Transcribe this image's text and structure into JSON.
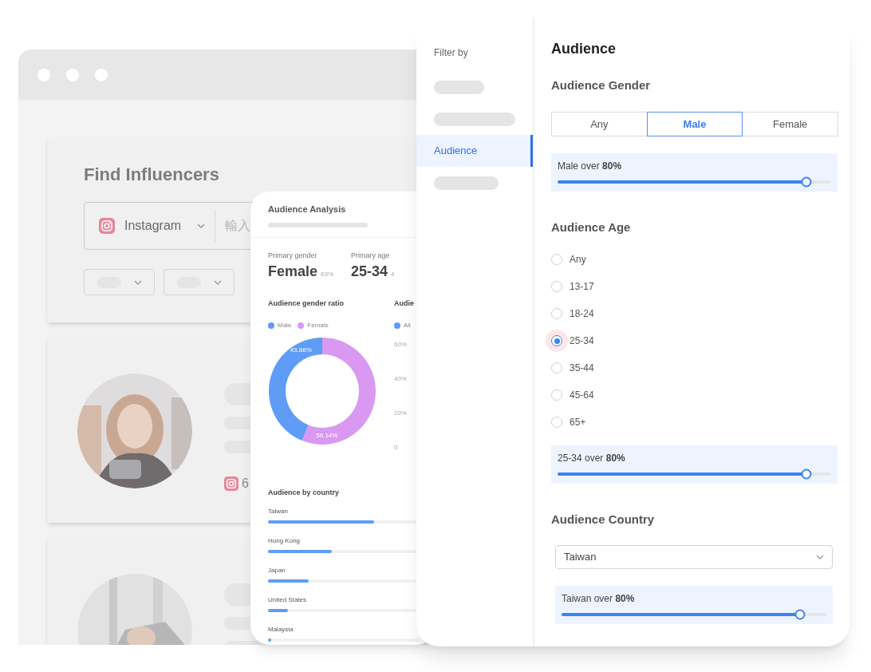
{
  "background_window": {
    "title": "Find Influencers",
    "platform_select": {
      "value": "Instagram"
    },
    "search": {
      "placeholder": "輸入"
    },
    "filters": [
      {
        "kind": "skeleton"
      },
      {
        "kind": "skeleton"
      }
    ],
    "results": [
      {
        "avatar": {
          "kind": "picture"
        },
        "follower_count": "6"
      },
      {
        "avatar": {
          "kind": "picture"
        }
      }
    ]
  },
  "analysis": {
    "title": "Audience Analysis",
    "primary_gender": {
      "label": "Primary gender",
      "value": "Female",
      "share": "63%"
    },
    "primary_age": {
      "label": "Primary age",
      "value": "25-34",
      "share": "4"
    },
    "gender_ratio": {
      "title": "Audience gender ratio",
      "legend": [
        {
          "color": "#5e9cf6"
        },
        {
          "color": "#d998f1"
        }
      ],
      "chart_data": {
        "type": "donut",
        "categories": [
          "Male",
          "Female"
        ],
        "series": [
          {
            "values": [
              43.86,
              56.14
            ]
          }
        ],
        "value_labels": [
          "43.86%",
          "56.14%"
        ]
      }
    },
    "age_chart": {
      "title": "Audie",
      "legend": [
        {
          "label": "All",
          "color": "#5e9cf6"
        }
      ],
      "axis_labels": [
        "60%",
        "40%",
        "20%",
        "0"
      ]
    },
    "by_country": {
      "title": "Audience by country",
      "countries": [
        {
          "name": "Taiwan",
          "level": 0.7
        },
        {
          "name": "Hong Kong",
          "level": 0.42
        },
        {
          "name": "Japan",
          "level": 0.27
        },
        {
          "name": "United States",
          "level": 0.13
        },
        {
          "name": "Malaysia",
          "level": 0.02
        }
      ]
    }
  },
  "filter_panel": {
    "sidebar": {
      "title": "Filter by",
      "items": [
        {
          "kind": "skeleton",
          "selected": false
        },
        {
          "kind": "skeleton",
          "selected": false
        },
        {
          "kind": "label",
          "label": "Audience",
          "selected": true
        },
        {
          "kind": "skeleton",
          "selected": false
        }
      ]
    },
    "title": "Audience",
    "sections": [
      {
        "kind": "segmented",
        "title": "Audience Gender",
        "options": [
          {
            "label": "Any",
            "selected": false
          },
          {
            "label": "Male",
            "selected": true
          },
          {
            "label": "Female",
            "selected": false
          }
        ],
        "threshold": {
          "label": "Male over **80%**",
          "level": 0.91
        }
      },
      {
        "kind": "radio",
        "title": "Audience Age",
        "options": [
          {
            "label": "Any",
            "selected": false
          },
          {
            "label": "13-17",
            "selected": false
          },
          {
            "label": "18-24",
            "selected": false
          },
          {
            "label": "25-34",
            "selected": true
          },
          {
            "label": "35-44",
            "selected": false
          },
          {
            "label": "45-64",
            "selected": false
          },
          {
            "label": "65+",
            "selected": false
          }
        ],
        "threshold": {
          "label": "25-34 over **80%**",
          "level": 0.91
        }
      },
      {
        "kind": "select",
        "title": "Audience Country",
        "value": "Taiwan",
        "threshold": {
          "label": "Taiwan over **80%**",
          "level": 0.9
        }
      }
    ]
  }
}
